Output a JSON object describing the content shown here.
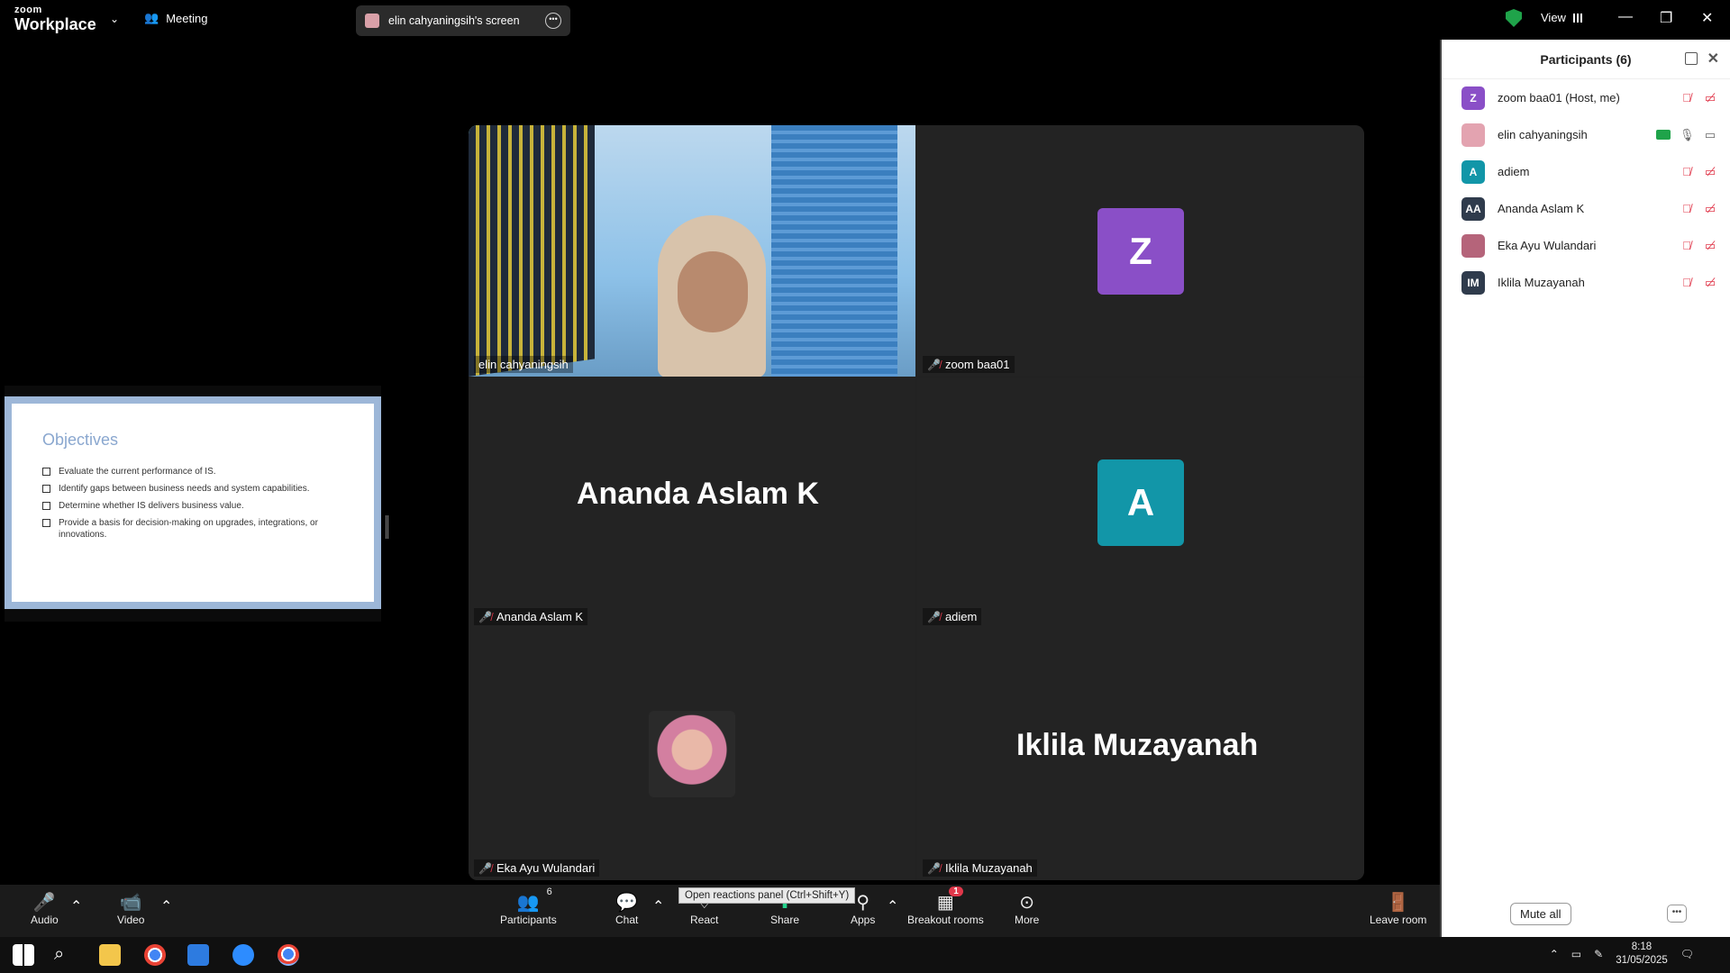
{
  "app": {
    "logo_top": "zoom",
    "logo_bottom": "Workplace",
    "meeting_menu": "Meeting",
    "share_pill": "elin cahyaningsih's screen",
    "view_label": "View"
  },
  "slide": {
    "title": "Objectives",
    "bullets": [
      "Evaluate the current performance of IS.",
      "Identify gaps between business needs and system capabilities.",
      "Determine whether IS delivers business value.",
      "Provide a basis for decision-making on upgrades, integrations, or innovations."
    ]
  },
  "tiles": [
    {
      "name": "elin cahyaningsih"
    },
    {
      "name": "zoom baa01",
      "initial": "Z",
      "color": "#8a4fc7"
    },
    {
      "name": "Ananda Aslam K",
      "display": "Ananda Aslam K"
    },
    {
      "name": "adiem",
      "initial": "A",
      "color": "#1296a8"
    },
    {
      "name": "Eka Ayu Wulandari"
    },
    {
      "name": "Iklila Muzayanah",
      "display": "Iklila Muzayanah"
    }
  ],
  "participants": {
    "title": "Participants (6)",
    "list": [
      {
        "name": "zoom baa01 (Host, me)",
        "avatar": "Z",
        "color": "#8a4fc7"
      },
      {
        "name": "elin cahyaningsih",
        "avatar": "",
        "color": "#e3a3b0"
      },
      {
        "name": "adiem",
        "avatar": "A",
        "color": "#1296a8"
      },
      {
        "name": "Ananda Aslam K",
        "avatar": "AA",
        "color": "#2f3b4c"
      },
      {
        "name": "Eka Ayu Wulandari",
        "avatar": "",
        "color": "#b5647a"
      },
      {
        "name": "Iklila Muzayanah",
        "avatar": "IM",
        "color": "#2f3b4c"
      }
    ],
    "mute_all": "Mute all"
  },
  "toolbar": {
    "audio": "Audio",
    "video": "Video",
    "participants": "Participants",
    "participants_count": "6",
    "chat": "Chat",
    "react": "React",
    "share": "Share",
    "apps": "Apps",
    "breakout": "Breakout rooms",
    "breakout_badge": "1",
    "more": "More",
    "leave": "Leave room",
    "tooltip": "Open reactions panel (Ctrl+Shift+Y)"
  },
  "taskbar": {
    "time": "8:18",
    "date": "31/05/2025"
  }
}
